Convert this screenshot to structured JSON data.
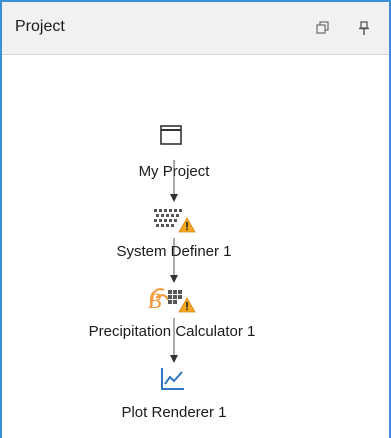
{
  "panel": {
    "title": "Project",
    "restore_icon": "restore-window-icon",
    "pin_icon": "pin-icon"
  },
  "tree": {
    "nodes": [
      {
        "label": "My Project",
        "icon": "project-window-icon"
      },
      {
        "label": "System Definer 1",
        "icon": "system-definer-icon",
        "warning": true
      },
      {
        "label": "Precipitation Calculator 1",
        "icon": "precipitation-calculator-icon",
        "warning": true
      },
      {
        "label": "Plot Renderer 1",
        "icon": "plot-renderer-icon"
      }
    ]
  },
  "colors": {
    "border_accent": "#3a8fd6",
    "warning": "#f5a623",
    "plot_icon": "#2f76c5"
  }
}
